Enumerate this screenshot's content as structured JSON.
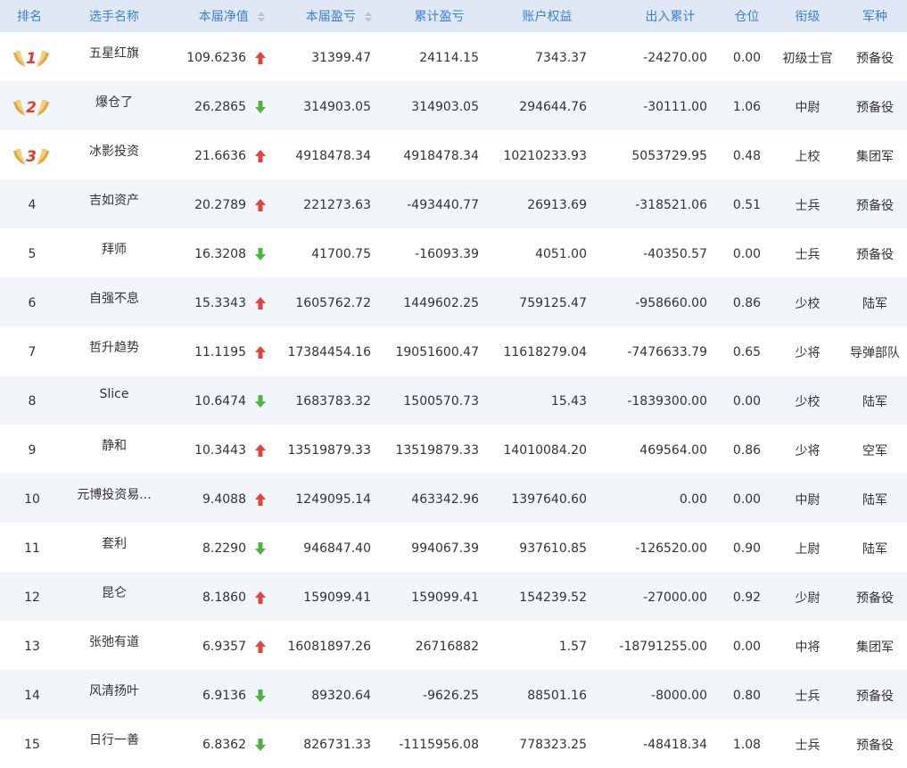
{
  "columns": {
    "rank": "排名",
    "name": "选手名称",
    "nav": "本届净值",
    "profit": "本届盈亏",
    "cum_profit": "累计盈亏",
    "equity": "账户权益",
    "inout": "出入累计",
    "position": "仓位",
    "title": "衔级",
    "branch": "军种"
  },
  "colors": {
    "header_bg": "#dfe8f4",
    "header_text": "#3e80d4",
    "up": "#e8413a",
    "down": "#4db53c"
  },
  "rows": [
    {
      "rank": "1",
      "medal": true,
      "name": "五星红旗",
      "nav": "109.6236",
      "trend": "up",
      "profit": "31399.47",
      "cum_profit": "24114.15",
      "equity": "7343.37",
      "inout": "-24270.00",
      "position": "0.00",
      "title": "初级士官",
      "branch": "预备役"
    },
    {
      "rank": "2",
      "medal": true,
      "name": "爆仓了",
      "nav": "26.2865",
      "trend": "down",
      "profit": "314903.05",
      "cum_profit": "314903.05",
      "equity": "294644.76",
      "inout": "-30111.00",
      "position": "1.06",
      "title": "中尉",
      "branch": "预备役"
    },
    {
      "rank": "3",
      "medal": true,
      "name": "冰影投资",
      "nav": "21.6636",
      "trend": "up",
      "profit": "4918478.34",
      "cum_profit": "4918478.34",
      "equity": "10210233.93",
      "inout": "5053729.95",
      "position": "0.48",
      "title": "上校",
      "branch": "集团军"
    },
    {
      "rank": "4",
      "medal": false,
      "name": "吉如资产",
      "nav": "20.2789",
      "trend": "up",
      "profit": "221273.63",
      "cum_profit": "-493440.77",
      "equity": "26913.69",
      "inout": "-318521.06",
      "position": "0.51",
      "title": "士兵",
      "branch": "预备役"
    },
    {
      "rank": "5",
      "medal": false,
      "name": "拜师",
      "nav": "16.3208",
      "trend": "down",
      "profit": "41700.75",
      "cum_profit": "-16093.39",
      "equity": "4051.00",
      "inout": "-40350.57",
      "position": "0.00",
      "title": "士兵",
      "branch": "预备役"
    },
    {
      "rank": "6",
      "medal": false,
      "name": "自强不息",
      "nav": "15.3343",
      "trend": "up",
      "profit": "1605762.72",
      "cum_profit": "1449602.25",
      "equity": "759125.47",
      "inout": "-958660.00",
      "position": "0.86",
      "title": "少校",
      "branch": "陆军"
    },
    {
      "rank": "7",
      "medal": false,
      "name": "哲升趋势",
      "nav": "11.1195",
      "trend": "up",
      "profit": "17384454.16",
      "cum_profit": "19051600.47",
      "equity": "11618279.04",
      "inout": "-7476633.79",
      "position": "0.65",
      "title": "少将",
      "branch": "导弹部队"
    },
    {
      "rank": "8",
      "medal": false,
      "name": "Slice",
      "nav": "10.6474",
      "trend": "down",
      "profit": "1683783.32",
      "cum_profit": "1500570.73",
      "equity": "15.43",
      "inout": "-1839300.00",
      "position": "0.00",
      "title": "少校",
      "branch": "陆军"
    },
    {
      "rank": "9",
      "medal": false,
      "name": "静和",
      "nav": "10.3443",
      "trend": "up",
      "profit": "13519879.33",
      "cum_profit": "13519879.33",
      "equity": "14010084.20",
      "inout": "469564.00",
      "position": "0.86",
      "title": "少将",
      "branch": "空军"
    },
    {
      "rank": "10",
      "medal": false,
      "name": "元博投资易...",
      "nav": "9.4088",
      "trend": "up",
      "profit": "1249095.14",
      "cum_profit": "463342.96",
      "equity": "1397640.60",
      "inout": "0.00",
      "position": "0.00",
      "title": "中尉",
      "branch": "陆军"
    },
    {
      "rank": "11",
      "medal": false,
      "name": "套利",
      "nav": "8.2290",
      "trend": "down",
      "profit": "946847.40",
      "cum_profit": "994067.39",
      "equity": "937610.85",
      "inout": "-126520.00",
      "position": "0.90",
      "title": "上尉",
      "branch": "陆军"
    },
    {
      "rank": "12",
      "medal": false,
      "name": "昆仑",
      "nav": "8.1860",
      "trend": "up",
      "profit": "159099.41",
      "cum_profit": "159099.41",
      "equity": "154239.52",
      "inout": "-27000.00",
      "position": "0.92",
      "title": "少尉",
      "branch": "预备役"
    },
    {
      "rank": "13",
      "medal": false,
      "name": "张弛有道",
      "nav": "6.9357",
      "trend": "up",
      "profit": "16081897.26",
      "cum_profit": "26716882",
      "equity": "1.57",
      "inout": "-18791255.00",
      "position": "0.00",
      "title": "中将",
      "branch": "集团军"
    },
    {
      "rank": "14",
      "medal": false,
      "name": "风清扬叶",
      "nav": "6.9136",
      "trend": "down",
      "profit": "89320.64",
      "cum_profit": "-9626.25",
      "equity": "88501.16",
      "inout": "-8000.00",
      "position": "0.80",
      "title": "士兵",
      "branch": "预备役"
    },
    {
      "rank": "15",
      "medal": false,
      "name": "日行一善",
      "nav": "6.8362",
      "trend": "down",
      "profit": "826731.33",
      "cum_profit": "-1115956.08",
      "equity": "778323.25",
      "inout": "-48418.34",
      "position": "1.08",
      "title": "士兵",
      "branch": "预备役"
    }
  ]
}
